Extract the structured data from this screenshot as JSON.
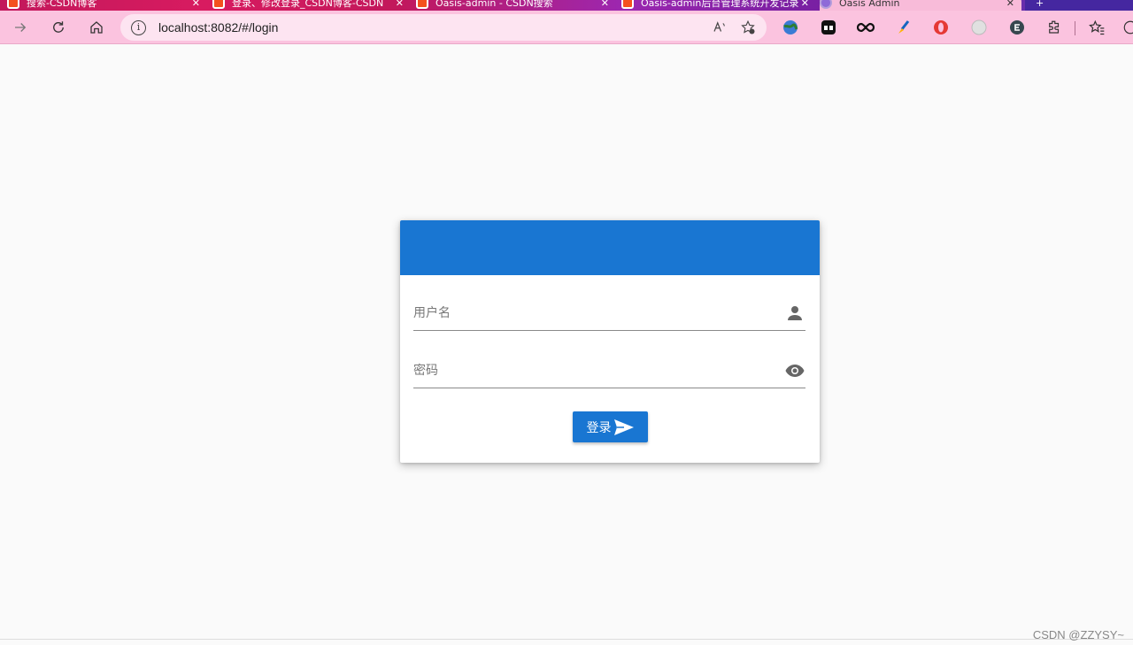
{
  "browser": {
    "tabs": [
      {
        "title": "搜索-CSDN博客"
      },
      {
        "title": "登录、修改登录_CSDN博客-CSDN"
      },
      {
        "title": "Oasis-admin - CSDN搜索"
      },
      {
        "title": "Oasis-admin后台管理系统开发记录"
      },
      {
        "title": "Oasis Admin"
      }
    ],
    "tab_close": "✕",
    "new_tab": "+",
    "address": "localhost:8082/#/login",
    "address_info": "i"
  },
  "login": {
    "username_placeholder": "用户名",
    "password_placeholder": "密码",
    "submit_label": "登录"
  },
  "watermark": "CSDN @ZZYSY~",
  "colors": {
    "primary": "#1976d2",
    "toolbar": "#fbc3df",
    "page_bg": "#fafafa"
  }
}
